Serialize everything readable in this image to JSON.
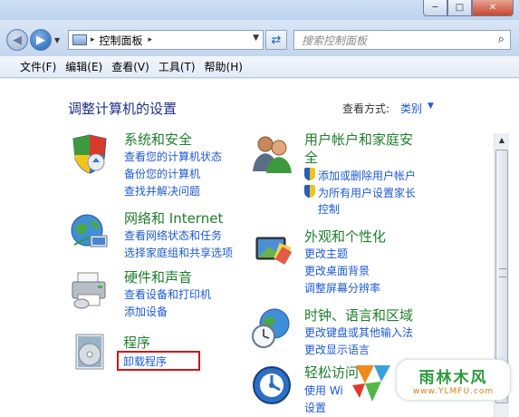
{
  "window": {
    "minimize": "─",
    "maximize": "□",
    "close": "✕"
  },
  "address": {
    "breadcrumb": "控制面板",
    "separator": "▸",
    "search_placeholder": "搜索控制面板"
  },
  "menu": [
    "文件(F)",
    "编辑(E)",
    "查看(V)",
    "工具(T)",
    "帮助(H)"
  ],
  "content": {
    "heading": "调整计算机的设置",
    "view_by_label": "查看方式:",
    "view_by_value": "类别"
  },
  "categories": {
    "system": {
      "title": "系统和安全",
      "links": [
        "查看您的计算机状态",
        "备份您的计算机",
        "查找并解决问题"
      ]
    },
    "network": {
      "title": "网络和 Internet",
      "links": [
        "查看网络状态和任务",
        "选择家庭组和共享选项"
      ]
    },
    "hardware": {
      "title": "硬件和声音",
      "links": [
        "查看设备和打印机",
        "添加设备"
      ]
    },
    "programs": {
      "title": "程序",
      "links": [
        "卸载程序"
      ]
    },
    "users": {
      "title_line1": "用户帐户和家庭安",
      "title_line2": "全",
      "links": [
        "添加或删除用户帐户",
        "为所有用户设置家长",
        "控制"
      ]
    },
    "appearance": {
      "title": "外观和个性化",
      "links": [
        "更改主题",
        "更改桌面背景",
        "调整屏幕分辨率"
      ]
    },
    "clock": {
      "title": "时钟、语言和区域",
      "links": [
        "更改键盘或其他输入法",
        "更改显示语言"
      ]
    },
    "ease": {
      "title": "轻松访问",
      "links": [
        "使用 Wi",
        "设置"
      ]
    }
  },
  "watermark": {
    "name": "雨林木风",
    "url": "www.YLMFU.com"
  },
  "icons": {
    "back": "back-arrow-icon",
    "forward": "forward-arrow-icon",
    "refresh": "refresh-icon",
    "search": "magnifier-icon"
  }
}
